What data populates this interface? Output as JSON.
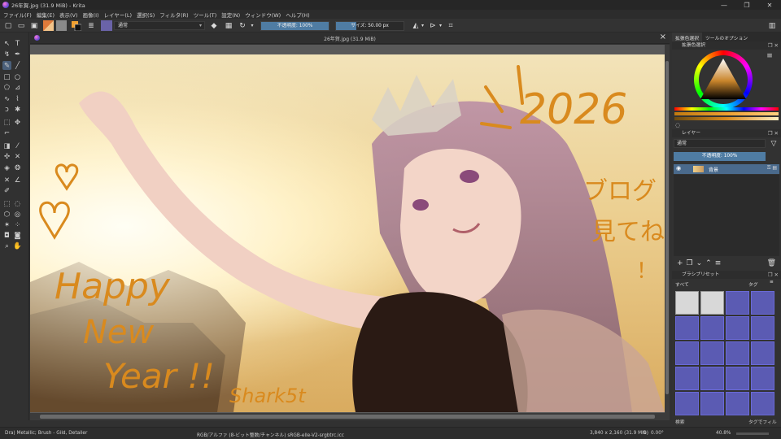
{
  "window": {
    "title": "26年賀.jpg (31.9 MiB)  - Krita",
    "controls": [
      "—",
      "❐",
      "✕"
    ]
  },
  "menu": [
    "ファイル(F)",
    "編集(E)",
    "表示(V)",
    "画像(I)",
    "レイヤー(L)",
    "選択(S)",
    "フィルタ(R)",
    "ツール(T)",
    "設定(N)",
    "ウィンドウ(W)",
    "ヘルプ(H)"
  ],
  "toolbar": {
    "blend_mode": "通常",
    "opacity_label": "不透明度: 100%",
    "opacity_value": 1.0,
    "size_label": "サイズ: 50.00 px",
    "size_fill": 0.3
  },
  "document": {
    "tab_title": "26年賀.jpg (31.9 MiB)"
  },
  "artwork": {
    "year": "2026",
    "happy": "Happy",
    "new": "New",
    "year_text": "Year !!",
    "blog_line1": "ブログ",
    "blog_line2": "見てね",
    "excl": "！",
    "signature": "Shark5t"
  },
  "right_panel": {
    "tabs": [
      "拡張色選択",
      "ツールのオプション"
    ],
    "color_header": "拡張色選択",
    "layers_header": "レイヤー",
    "layer_blend": "通常",
    "layer_opacity": "不透明度: 100%",
    "layer_name": "背景",
    "presets_header": "ブラシプリセット",
    "preset_filter": "すべて",
    "preset_tag": "タグ",
    "preset_search": "検索",
    "filter_by_tag": "タグでフィルタ"
  },
  "status": {
    "brush": "Dra) Metallic; Brush - Gild, Detailer",
    "color_info": "RGB/アルファ (8-ビット整数/チャンネル)  sRGB-elle-V2-srgbtrc.icc",
    "dimensions": "3,840 x 2,160 (31.9 MiB)",
    "rotation": "0.00°",
    "zoom": "40.8%"
  },
  "colors": {
    "accent": "#4f7ca3",
    "handwriting": "#d98a1e"
  }
}
